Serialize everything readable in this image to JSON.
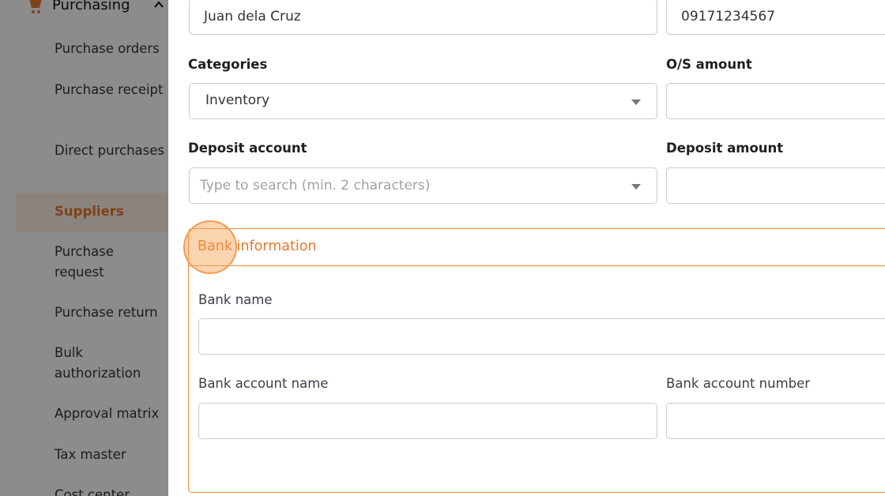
{
  "sidebar": {
    "section_label": "Purchasing",
    "items": [
      {
        "label": "Purchase orders"
      },
      {
        "label": "Purchase receipt"
      },
      {
        "label": "Direct purchases"
      },
      {
        "label": "Suppliers"
      },
      {
        "label": "Purchase request"
      },
      {
        "label": "Purchase return"
      },
      {
        "label": "Bulk authorization"
      },
      {
        "label": "Approval matrix"
      },
      {
        "label": "Tax master"
      },
      {
        "label": "Cost center"
      }
    ],
    "active_item": "Suppliers"
  },
  "form": {
    "contact_name_value": "Juan dela Cruz",
    "phone_value": "09171234567",
    "categories_label": "Categories",
    "categories_value": "Inventory",
    "os_amount_label": "O/S amount",
    "deposit_account_label": "Deposit account",
    "deposit_account_placeholder": "Type to search (min. 2 characters)",
    "deposit_amount_label": "Deposit amount",
    "bank": {
      "title": "Bank information",
      "bank_name_label": "Bank name",
      "bank_account_name_label": "Bank account name",
      "bank_account_number_label": "Bank account number"
    }
  },
  "colors": {
    "accent": "#e8772e",
    "active_bg": "#fdf0e6",
    "border": "#c9c9cf"
  }
}
